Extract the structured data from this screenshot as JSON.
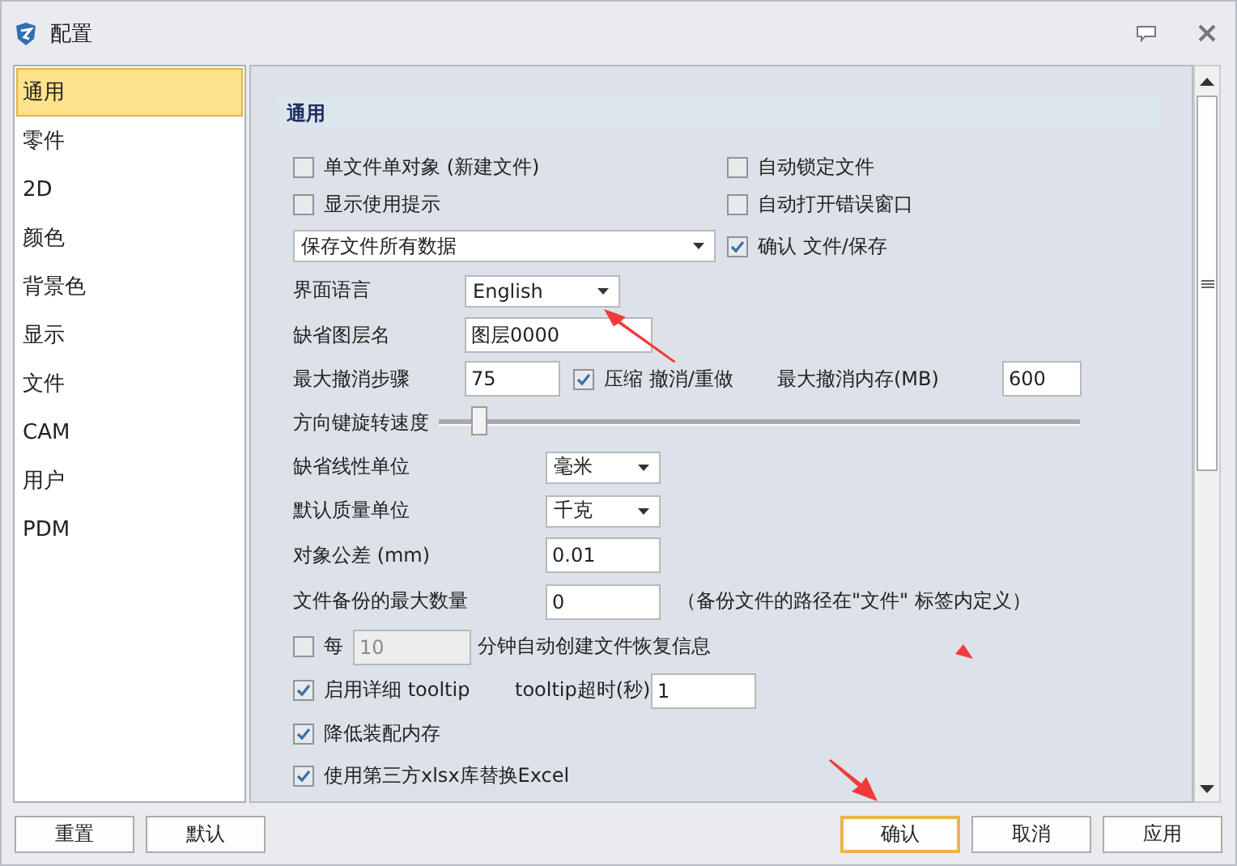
{
  "window": {
    "title": "配置"
  },
  "sidebar": {
    "items": [
      {
        "label": "通用",
        "selected": true
      },
      {
        "label": "零件",
        "selected": false
      },
      {
        "label": "2D",
        "selected": false
      },
      {
        "label": "颜色",
        "selected": false
      },
      {
        "label": "背景色",
        "selected": false
      },
      {
        "label": "显示",
        "selected": false
      },
      {
        "label": "文件",
        "selected": false
      },
      {
        "label": "CAM",
        "selected": false
      },
      {
        "label": "用户",
        "selected": false
      },
      {
        "label": "PDM",
        "selected": false
      }
    ]
  },
  "panel": {
    "heading": "通用",
    "single_file_single_object": {
      "label": "单文件单对象 (新建文件)",
      "checked": false
    },
    "auto_lock_file": {
      "label": "自动锁定文件",
      "checked": false
    },
    "show_usage_tips": {
      "label": "显示使用提示",
      "checked": false
    },
    "auto_open_error_window": {
      "label": "自动打开错误窗口",
      "checked": false
    },
    "save_mode": {
      "value": "保存文件所有数据"
    },
    "confirm_save": {
      "label": "确认 文件/保存",
      "checked": true
    },
    "language": {
      "label": "界面语言",
      "value": "English"
    },
    "default_layer": {
      "label": "缺省图层名",
      "value": "图层0000"
    },
    "max_undo_steps": {
      "label": "最大撤消步骤",
      "value": "75"
    },
    "compress_undo": {
      "label": "压缩 撤消/重做",
      "checked": true
    },
    "max_undo_memory": {
      "label": "最大撤消内存(MB)",
      "value": "600"
    },
    "rotation_speed": {
      "label": "方向键旋转速度",
      "level": 0.05
    },
    "linear_unit": {
      "label": "缺省线性单位",
      "value": "毫米"
    },
    "mass_unit": {
      "label": "默认质量单位",
      "value": "千克"
    },
    "tolerance": {
      "label": "对象公差 (mm)",
      "value": "0.01"
    },
    "max_backups": {
      "label": "文件备份的最大数量",
      "value": "0",
      "note": "（备份文件的路径在\"文件\" 标签内定义）"
    },
    "autosave": {
      "checked": false,
      "prefix": "每",
      "value": "10",
      "disabled": true,
      "suffix": "分钟自动创建文件恢复信息"
    },
    "detailed_tooltip": {
      "label": "启用详细 tooltip",
      "checked": true
    },
    "tooltip_timeout": {
      "label": "tooltip超时(秒)",
      "value": "1"
    },
    "reduce_assembly_memory": {
      "label": "降低装配内存",
      "checked": true
    },
    "use_xlsx_library": {
      "label": "使用第三方xlsx库替换Excel",
      "checked": true
    }
  },
  "buttons_left": [
    {
      "label": "重置",
      "focused": false
    },
    {
      "label": "默认",
      "focused": false
    }
  ],
  "buttons_right": [
    {
      "label": "确认",
      "focused": true
    },
    {
      "label": "取消",
      "focused": false
    },
    {
      "label": "应用",
      "focused": false
    }
  ]
}
